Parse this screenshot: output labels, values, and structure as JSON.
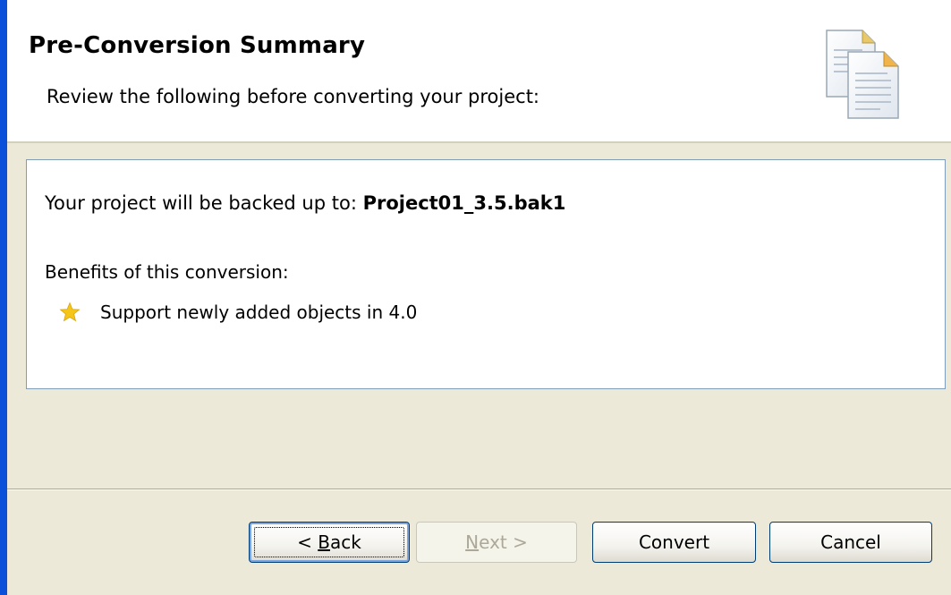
{
  "header": {
    "title": "Pre-Conversion Summary",
    "subtitle": "Review the following before converting your project:",
    "icon": "documents-icon"
  },
  "content": {
    "backup_prefix": "Your project will be backed up to: ",
    "backup_name": "Project01_3.5.bak1",
    "benefits_label": "Benefits of this conversion:",
    "benefits": [
      {
        "icon": "star-icon",
        "label": "Support newly added objects in 4.0"
      }
    ]
  },
  "buttons": {
    "back": {
      "prefix": "< ",
      "mnemonic": "B",
      "rest": "ack",
      "enabled": true
    },
    "next": {
      "mnemonic": "N",
      "rest": "ext >",
      "enabled": false
    },
    "convert": {
      "label": "Convert",
      "enabled": true
    },
    "cancel": {
      "label": "Cancel",
      "enabled": true
    }
  },
  "colors": {
    "accent": "#0a50d8",
    "dialog_bg": "#ece9d8",
    "button_border": "#003c74",
    "star": "#f5c518"
  }
}
